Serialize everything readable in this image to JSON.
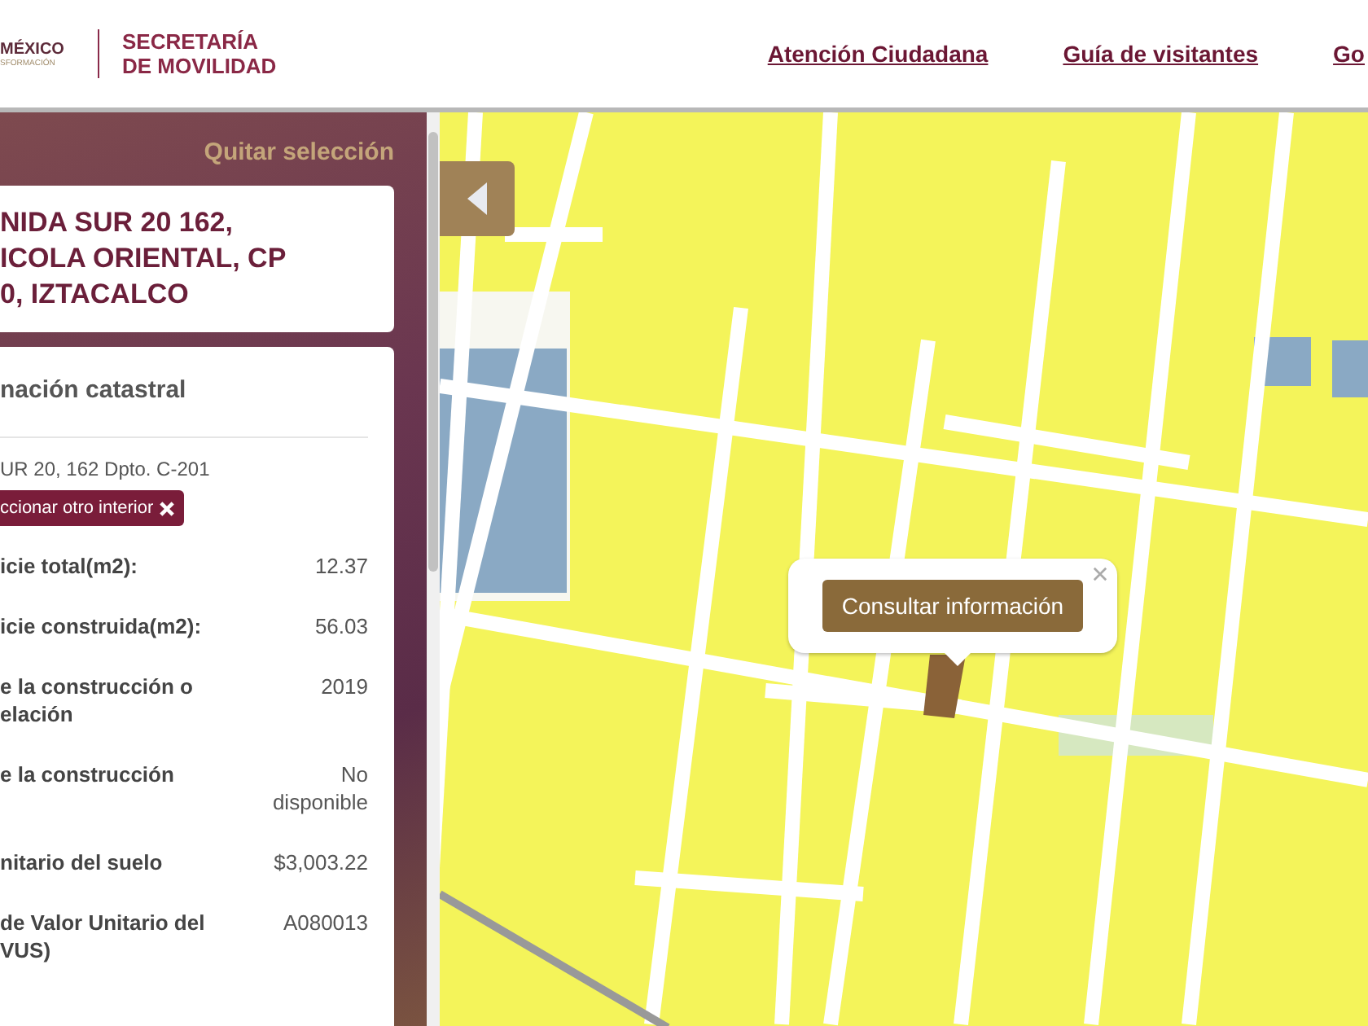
{
  "header": {
    "logo": {
      "name": "MÉXICO",
      "tagline": "SFORMACIÓN"
    },
    "agency": [
      "SECRETARÍA",
      "DE MOVILIDAD"
    ],
    "nav": [
      "Atención Ciudadana",
      "Guía de visitantes",
      "Go"
    ]
  },
  "sidebar": {
    "clear_selection": "Quitar selección",
    "address": [
      "NIDA SUR 20 162,",
      "ICOLA ORIENTAL, CP",
      "0, IZTACALCO"
    ],
    "card": {
      "title": "nación catastral",
      "unit": "UR 20, 162 Dpto. C-201",
      "change_button": "ccionar otro interior",
      "rows": [
        {
          "label": "icie total(m2):",
          "value": "12.37"
        },
        {
          "label": "icie construida(m2):",
          "value": "56.03"
        },
        {
          "label": "e la construcción o\nelación",
          "value": "2019"
        },
        {
          "label": "e la construcción",
          "value": "No\ndisponible"
        },
        {
          "label": "nitario del suelo",
          "value": "$3,003.22"
        },
        {
          "label": "de Valor Unitario del\nVUS)",
          "value": "A080013"
        }
      ]
    }
  },
  "map": {
    "popup": {
      "button": "Consultar información"
    }
  }
}
